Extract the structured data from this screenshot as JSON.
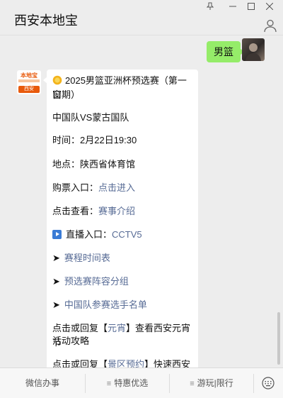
{
  "app": {
    "title": "西安本地宝"
  },
  "window_controls": [
    "pin-icon",
    "minimize-icon",
    "maximize-icon",
    "close-icon"
  ],
  "user_message": {
    "text": "男篮"
  },
  "bot": {
    "logo_top": "本地宝",
    "logo_bottom": "西安"
  },
  "message": {
    "line1": "2025男篮亚洲杯预选赛（第一窗",
    "line2": "口期）",
    "matchup": "中国队VS蒙古国队",
    "time_label": "时间：",
    "time_value": "2月22日19:30",
    "venue_label": "地点：",
    "venue_value": "陕西省体育馆",
    "ticket_label": "购票入口：",
    "ticket_link": "点击进入",
    "view_label": "点击查看：",
    "view_link": "赛事介绍",
    "live_label": "直播入口：",
    "live_link": "CCTV5",
    "arrow": "➤",
    "link_schedule": "赛程时间表",
    "link_groups": "预选赛阵容分组",
    "link_roster": "中国队参赛选手名单",
    "reply1_pre": "点击或回复【",
    "reply1_link": "元宵",
    "reply1_post": "】查看西安元宵节",
    "reply1_line2": "活动攻略",
    "reply2_pre": "点击或回复【",
    "reply2_link": "景区预约",
    "reply2_post": "】快速西安热"
  },
  "bottom_menu": {
    "item1": "微信办事",
    "item2": "特惠优选",
    "item3": "游玩|限行",
    "hamburger": "≡"
  },
  "colors": {
    "link": "#576b95",
    "my_bubble": "#95ec69",
    "accent": "#e85a0c"
  }
}
